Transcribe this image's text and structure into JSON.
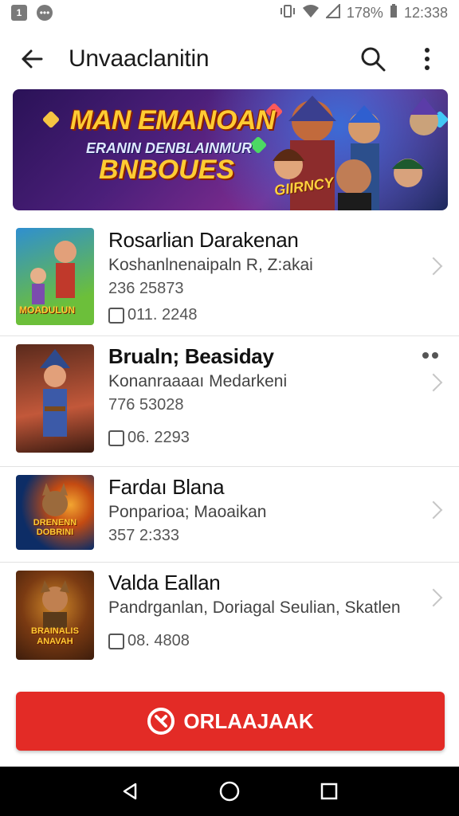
{
  "status_bar": {
    "left_badge": "1",
    "battery": "178%",
    "time": "12:338"
  },
  "app_bar": {
    "title": "Unvaaclanitin"
  },
  "banner": {
    "title": "MAN EMANOAN",
    "subtitle": "ERANIN DENBLAINMUR",
    "title2": "BNBOUES",
    "tag": "GIIRNCY"
  },
  "list": [
    {
      "title": "Rosarlian Darakenan",
      "subtitle": "Koshanlnenaipaln R, Z:akai",
      "number": "236 25873",
      "meta": "011. 2248",
      "thumb_text": "MOADULUN",
      "colors": [
        "#2f8fd0",
        "#6cbf3a"
      ]
    },
    {
      "title": "Brualn; Beasiday",
      "subtitle": "Konanraaaaı Medarkeni",
      "number": "776 53028",
      "meta": "06. 2293",
      "thumb_text": "",
      "colors": [
        "#5a2a1c",
        "#c2583a"
      ]
    },
    {
      "title": "Fardaı Blana",
      "subtitle": "Ponparioa; Maoaikan",
      "number": "357 2:333",
      "meta": "",
      "thumb_text": "DRENENN DOBRINI",
      "colors": [
        "#0d2d66",
        "#f2a531"
      ]
    },
    {
      "title": "Valda Eallan",
      "subtitle": "Pandrganlan, Doriagal Seulian, Skatlen",
      "number": "",
      "meta": "08. 4808",
      "thumb_text": "BRAINALIS ANAVAH",
      "colors": [
        "#3d1d0c",
        "#d18a2a"
      ]
    }
  ],
  "cta": {
    "label": "ORLAAJAAK"
  },
  "colors": {
    "accent": "#e32b26",
    "nav_bg": "#000000"
  }
}
